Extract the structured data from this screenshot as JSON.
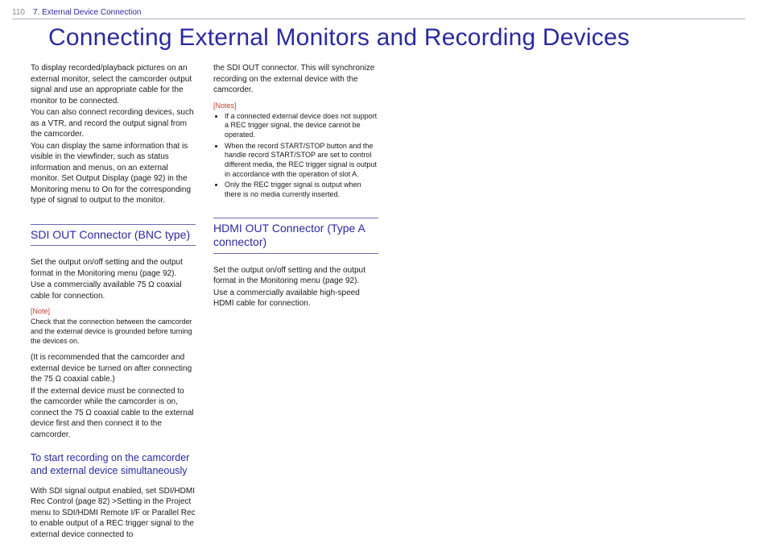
{
  "page_number": "110",
  "section_label": "7. External Device Connection",
  "title": "Connecting External Monitors and Recording Devices",
  "col1": {
    "intro_p1": "To display recorded/playback pictures on an external monitor, select the camcorder output signal and use an appropriate cable for the monitor to be connected.",
    "intro_p2": "You can also connect recording devices, such as a VTR, and record the output signal from the camcorder.",
    "intro_p3": "You can display the same information that is visible in the viewfinder, such as status information and menus, on an external monitor. Set Output Display (page 92) in the Monitoring menu to On for the corresponding type of signal to output to the monitor.",
    "sdi_head": "SDI OUT Connector (BNC type)",
    "sdi_p1": "Set the output on/off setting and the output format in the Monitoring menu (page 92).",
    "sdi_p2": "Use a commercially available 75 Ω coaxial cable for connection.",
    "note_label": "[Note]",
    "note_text": "Check that the connection between the camcorder and the external device is grounded before turning the devices on.",
    "sdi_p3": "(It is recommended that the camcorder and external device be turned on after connecting the 75 Ω coaxial cable.)",
    "sdi_p4": "If the external device must be connected to the camcorder while the camcorder is on, connect the 75 Ω coaxial cable to the external device first and then connect it to the camcorder.",
    "subsub": "To start recording on the camcorder and external device simultaneously",
    "sdi_p5": "With SDI signal output enabled, set SDI/HDMI Rec Control (page 82) >Setting in the Project menu to SDI/HDMI Remote I/F or Parallel Rec to enable output of a REC trigger signal to the external device connected to"
  },
  "col2": {
    "cont_p1": "the SDI OUT connector. This will synchronize recording on the external device with the camcorder.",
    "notes_label": "[Notes]",
    "note_items": [
      "If a connected external device does not support a REC trigger signal, the device cannot be operated.",
      "When the record START/STOP button and the handle record START/STOP are set to control different media, the REC trigger signal is output in accordance with the operation of slot A.",
      "Only the REC trigger signal is output when there is no media currently inserted."
    ],
    "hdmi_head": "HDMI OUT Connector (Type A connector)",
    "hdmi_p1": "Set the output on/off setting and the output format in the Monitoring menu (page 92).",
    "hdmi_p2": "Use a commercially available high-speed HDMI cable for connection."
  }
}
